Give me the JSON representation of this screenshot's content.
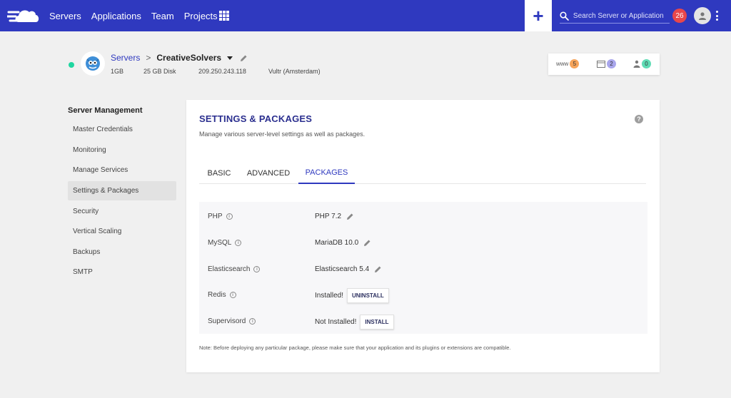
{
  "nav": {
    "items": [
      "Servers",
      "Applications",
      "Team",
      "Projects"
    ],
    "search_placeholder": "Search Server or Application",
    "notification_count": "26"
  },
  "server": {
    "breadcrumb_root": "Servers",
    "breadcrumb_sep": ">",
    "name": "CreativeSolvers",
    "ram": "1GB",
    "disk": "25 GB Disk",
    "ip": "209.250.243.118",
    "location": "Vultr (Amsterdam)",
    "counters": {
      "www_label": "www",
      "www_count": "5",
      "apps_count": "2",
      "users_count": "0"
    }
  },
  "sidebar": {
    "title": "Server Management",
    "items": [
      "Master Credentials",
      "Monitoring",
      "Manage Services",
      "Settings & Packages",
      "Security",
      "Vertical Scaling",
      "Backups",
      "SMTP"
    ]
  },
  "card": {
    "title": "SETTINGS & PACKAGES",
    "subtitle": "Manage various server-level settings as well as packages.",
    "help": "?",
    "tabs": [
      "BASIC",
      "ADVANCED",
      "PACKAGES"
    ],
    "packages": [
      {
        "name": "PHP",
        "value": "PHP 7.2"
      },
      {
        "name": "MySQL",
        "value": "MariaDB 10.0"
      },
      {
        "name": "Elasticsearch",
        "value": "Elasticsearch 5.4"
      },
      {
        "name": "Redis",
        "value": "Installed!",
        "button": "UNINSTALL"
      },
      {
        "name": "Supervisord",
        "value": "Not Installed!",
        "button": "INSTALL"
      }
    ],
    "note": "Note: Before deploying any particular package, please make sure that your application and its plugins or extensions are compatible."
  },
  "colors": {
    "brand": "#2f39bf",
    "status_online": "#1fd6a0",
    "notification": "#e8474b",
    "www_badge": "#f6a45a",
    "apps_badge": "#a9a6ec",
    "users_badge": "#5fdcb5"
  },
  "icons": [
    "cloudways-logo-icon",
    "apps-grid-icon",
    "plus-icon",
    "search-icon",
    "user-avatar-icon",
    "kebab-menu-icon",
    "server-mascot-icon",
    "edit-pencil-icon",
    "browser-window-icon",
    "users-icon",
    "help-icon",
    "info-icon"
  ]
}
